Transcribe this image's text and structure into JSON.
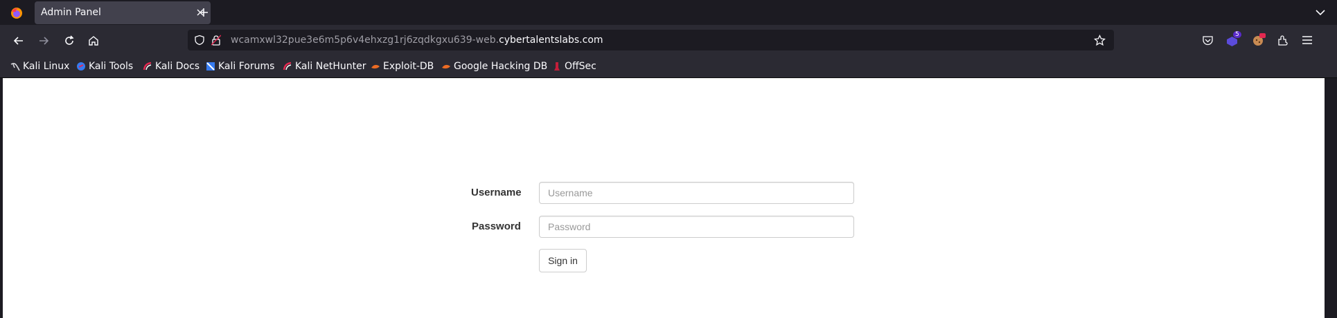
{
  "browser": {
    "tab_title": "Admin Panel",
    "url_subdomain": "wcamxwl32pue3e6m5p6v4ehxzg1rj6zqdkgxu639-web.",
    "url_domain": "cybertalentslabs.com",
    "extension_badge": "5",
    "bookmarks": [
      {
        "label": "Kali Linux",
        "icon": "kali-dragon-icon"
      },
      {
        "label": "Kali Tools",
        "icon": "kali-tools-icon"
      },
      {
        "label": "Kali Docs",
        "icon": "kali-docs-icon"
      },
      {
        "label": "Kali Forums",
        "icon": "kali-forums-icon"
      },
      {
        "label": "Kali NetHunter",
        "icon": "kali-nethunter-icon"
      },
      {
        "label": "Exploit-DB",
        "icon": "exploit-db-icon"
      },
      {
        "label": "Google Hacking DB",
        "icon": "ghdb-icon"
      },
      {
        "label": "OffSec",
        "icon": "offsec-icon"
      }
    ]
  },
  "login_form": {
    "username_label": "Username",
    "username_placeholder": "Username",
    "username_value": "",
    "password_label": "Password",
    "password_placeholder": "Password",
    "password_value": "",
    "signin_label": "Sign in"
  },
  "colors": {
    "tab_bar_bg": "#1c1b22",
    "toolbar_bg": "#2b2a33",
    "active_tab_bg": "#42414d",
    "page_bg": "#ffffff"
  }
}
